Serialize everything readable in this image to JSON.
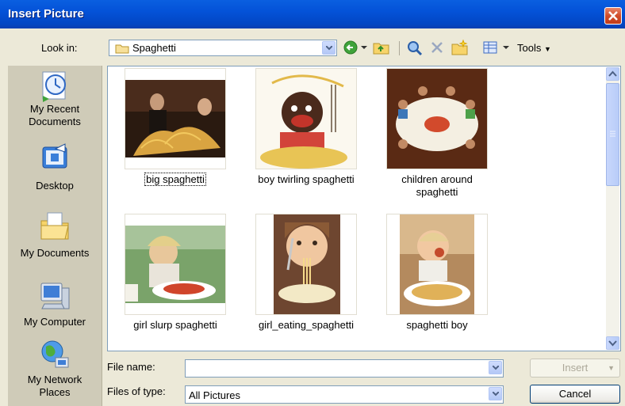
{
  "window": {
    "title": "Insert Picture"
  },
  "lookin": {
    "label": "Look in:",
    "value": "Spaghetti"
  },
  "toolbar": {
    "tools_label": "Tools"
  },
  "places": [
    {
      "label_line1": "My Recent",
      "label_line2": "Documents"
    },
    {
      "label_line1": "Desktop",
      "label_line2": ""
    },
    {
      "label_line1": "My Documents",
      "label_line2": ""
    },
    {
      "label_line1": "My Computer",
      "label_line2": ""
    },
    {
      "label_line1": "My Network",
      "label_line2": "Places"
    }
  ],
  "files": [
    {
      "name": "big spaghetti",
      "line2": ""
    },
    {
      "name": "boy twirling spaghetti",
      "line2": ""
    },
    {
      "name": "children around",
      "line2": "spaghetti"
    },
    {
      "name": "girl slurp spaghetti",
      "line2": ""
    },
    {
      "name": "girl_eating_spaghetti",
      "line2": ""
    },
    {
      "name": "spaghetti boy",
      "line2": ""
    }
  ],
  "filename": {
    "label": "File name:",
    "value": ""
  },
  "filetype": {
    "label": "Files of type:",
    "value": "All Pictures"
  },
  "buttons": {
    "insert": "Insert",
    "cancel": "Cancel"
  },
  "colors": {
    "titlebar": "#0452d8",
    "dialog_bg": "#ece9d8",
    "places_bg": "#cfcbb8"
  }
}
